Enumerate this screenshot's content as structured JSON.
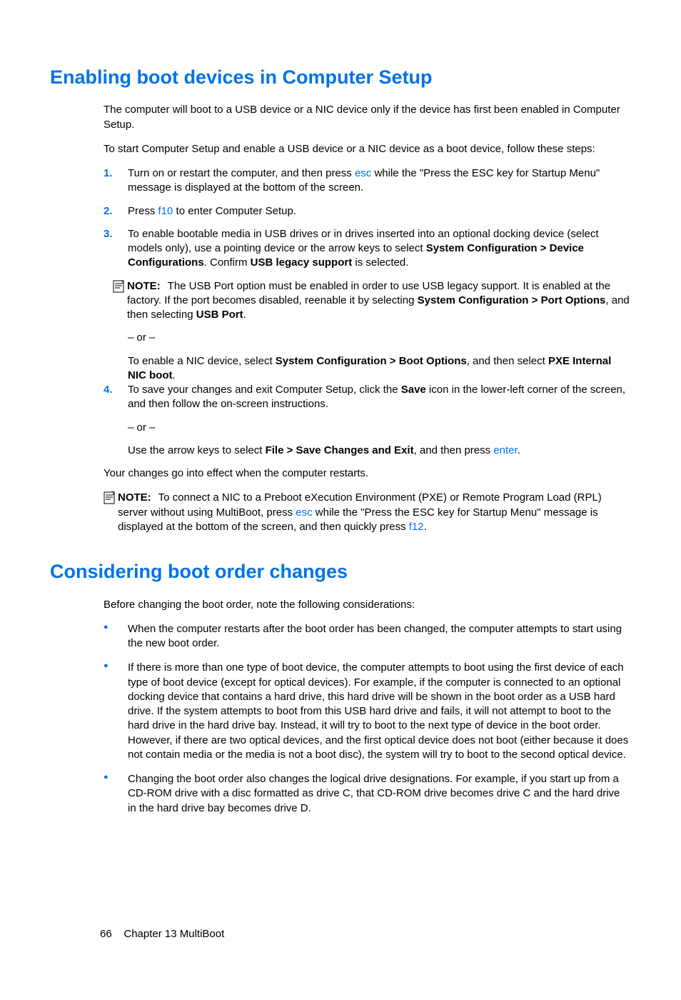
{
  "section1": {
    "heading": "Enabling boot devices in Computer Setup",
    "intro1": "The computer will boot to a USB device or a NIC device only if the device has first been enabled in Computer Setup.",
    "intro2": "To start Computer Setup and enable a USB device or a NIC device as a boot device, follow these steps:",
    "step1_a": "Turn on or restart the computer, and then press ",
    "step1_key": "esc",
    "step1_b": " while the \"Press the ESC key for Startup Menu\" message is displayed at the bottom of the screen.",
    "step2_a": "Press ",
    "step2_key": "f10",
    "step2_b": " to enter Computer Setup.",
    "step3_a": "To enable bootable media in USB drives or in drives inserted into an optional docking device (select models only), use a pointing device or the arrow keys to select ",
    "step3_bold1": "System Configuration > Device Configurations",
    "step3_b": ". Confirm ",
    "step3_bold2": "USB legacy support",
    "step3_c": " is selected.",
    "note1_label": "NOTE:",
    "note1_a": "The USB Port option must be enabled in order to use USB legacy support. It is enabled at the factory. If the port becomes disabled, reenable it by selecting ",
    "note1_bold1": "System Configuration > Port Options",
    "note1_b": ", and then selecting ",
    "note1_bold2": "USB Port",
    "note1_c": ".",
    "or": "– or –",
    "step3_sub2_a": "To enable a NIC device, select ",
    "step3_sub2_bold1": "System Configuration > Boot Options",
    "step3_sub2_b": ", and then select ",
    "step3_sub2_bold2": "PXE Internal NIC boot",
    "step3_sub2_c": ".",
    "step4_a": "To save your changes and exit Computer Setup, click the ",
    "step4_bold1": "Save",
    "step4_b": " icon in the lower-left corner of the screen, and then follow the on-screen instructions.",
    "step4_sub2_a": "Use the arrow keys to select ",
    "step4_sub2_bold1": "File > Save Changes and Exit",
    "step4_sub2_b": ", and then press ",
    "step4_sub2_key": "enter",
    "step4_sub2_c": ".",
    "outro": "Your changes go into effect when the computer restarts.",
    "note2_label": "NOTE:",
    "note2_a": "To connect a NIC to a Preboot eXecution Environment (PXE) or Remote Program Load (RPL) server without using MultiBoot, press ",
    "note2_key1": "esc",
    "note2_b": " while the \"Press the ESC key for Startup Menu\" message is displayed at the bottom of the screen, and then quickly press ",
    "note2_key2": "f12",
    "note2_c": "."
  },
  "section2": {
    "heading": "Considering boot order changes",
    "intro": "Before changing the boot order, note the following considerations:",
    "b1": "When the computer restarts after the boot order has been changed, the computer attempts to start using the new boot order.",
    "b2": "If there is more than one type of boot device, the computer attempts to boot using the first device of each type of boot device (except for optical devices). For example, if the computer is connected to an optional docking device that contains a hard drive, this hard drive will be shown in the boot order as a USB hard drive. If the system attempts to boot from this USB hard drive and fails, it will not attempt to boot to the hard drive in the hard drive bay. Instead, it will try to boot to the next type of device in the boot order. However, if there are two optical devices, and the first optical device does not boot (either because it does not contain media or the media is not a boot disc), the system will try to boot to the second optical device.",
    "b3": "Changing the boot order also changes the logical drive designations. For example, if you start up from a CD-ROM drive with a disc formatted as drive C, that CD-ROM drive becomes drive C and the hard drive in the hard drive bay becomes drive D."
  },
  "footer": {
    "page": "66",
    "chapter": "Chapter 13   MultiBoot"
  }
}
